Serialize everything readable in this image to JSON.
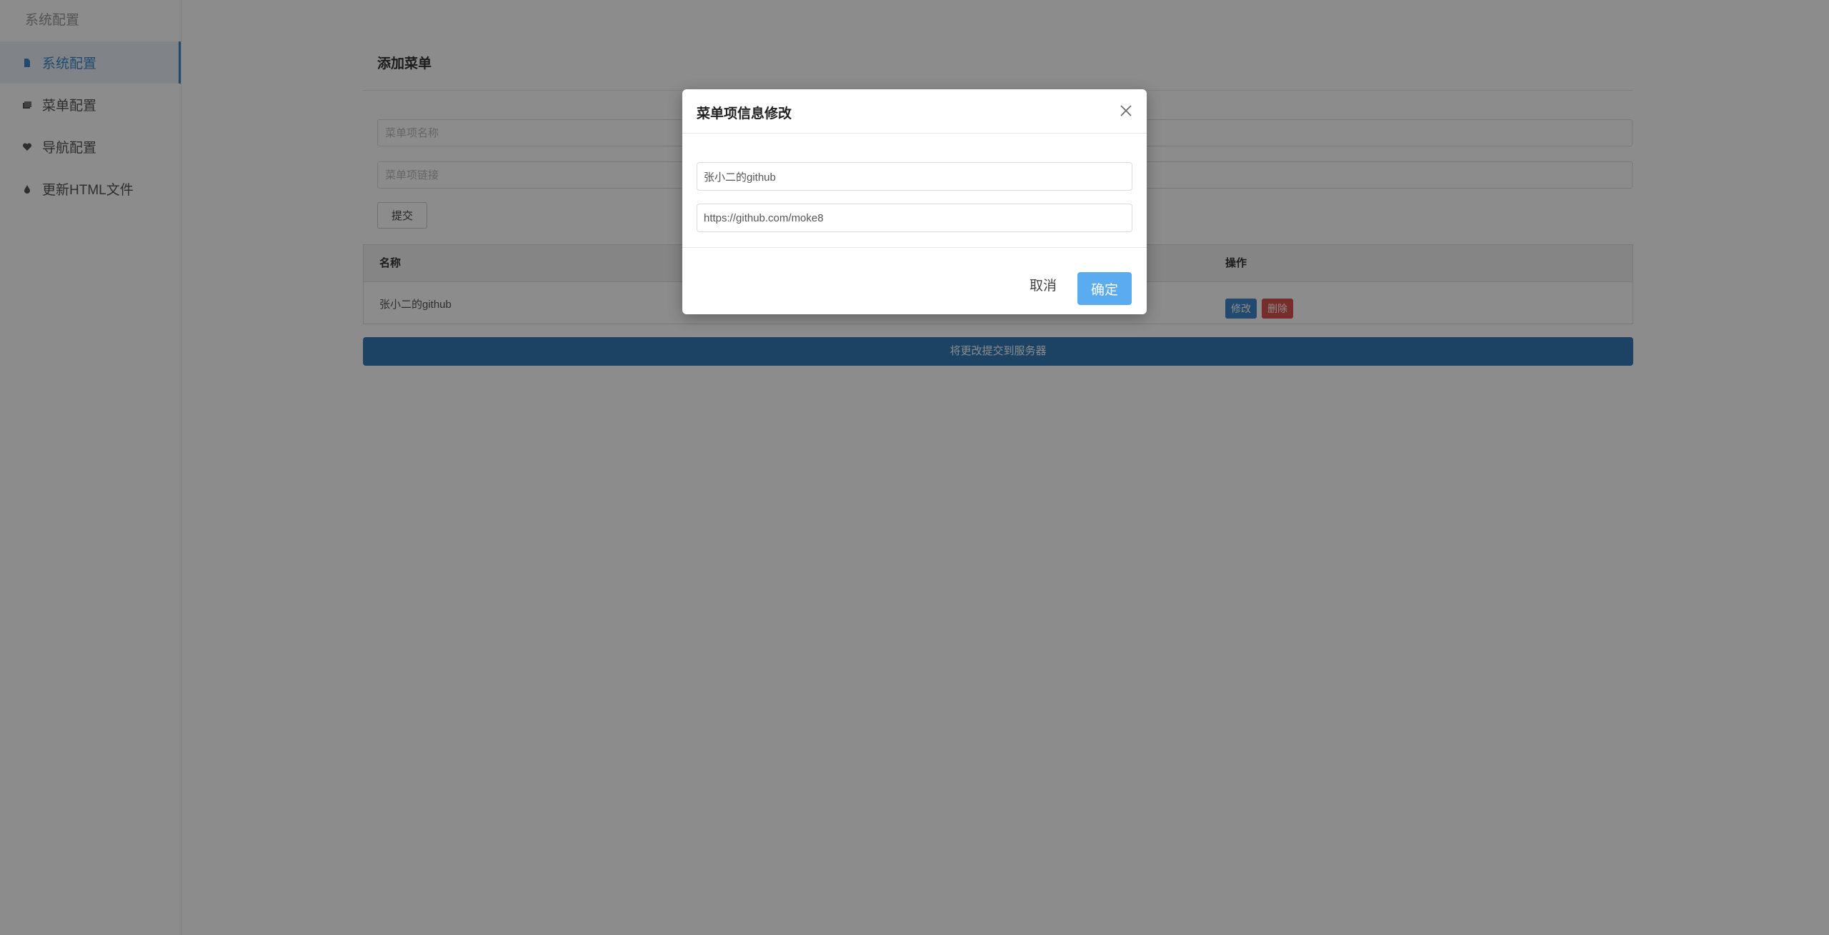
{
  "sidebar": {
    "title": "系统配置",
    "items": [
      {
        "label": "系统配置",
        "icon": "document-icon",
        "active": true
      },
      {
        "label": "菜单配置",
        "icon": "stack-icon",
        "active": false
      },
      {
        "label": "导航配置",
        "icon": "heart-icon",
        "active": false
      },
      {
        "label": "更新HTML文件",
        "icon": "drop-icon",
        "active": false
      }
    ]
  },
  "main": {
    "title": "添加菜单",
    "name_placeholder": "菜单项名称",
    "link_placeholder": "菜单项链接",
    "submit_label": "提交",
    "table": {
      "columns": [
        "名称",
        "操作"
      ],
      "rows": [
        {
          "name": "张小二的github",
          "edit_label": "修改",
          "delete_label": "删除"
        }
      ]
    },
    "save_label": "将更改提交到服务器"
  },
  "modal": {
    "title": "菜单项信息修改",
    "name_value": "张小二的github",
    "link_value": "https://github.com/moke8",
    "cancel_label": "取消",
    "ok_label": "确定"
  },
  "colors": {
    "accent": "#3e86c8",
    "danger": "#d9534f",
    "primary_bar": "#337ab7",
    "ok_button": "#5aabf0"
  }
}
